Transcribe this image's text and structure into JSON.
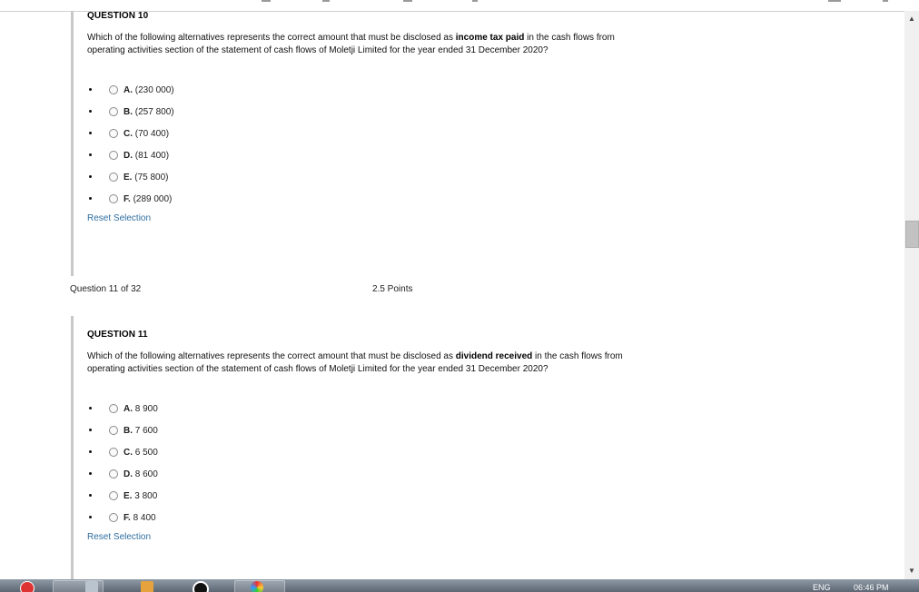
{
  "question10": {
    "heading": "QUESTION 10",
    "text_before": "Which of the following alternatives represents the correct amount that must be disclosed as ",
    "text_bold": "income tax paid",
    "text_after": " in the cash flows from operating activities section of the statement of cash flows of Moletji Limited for the year ended 31 December 2020?",
    "options": [
      {
        "letter": "A.",
        "value": "(230 000)"
      },
      {
        "letter": "B.",
        "value": "(257 800)"
      },
      {
        "letter": "C.",
        "value": "(70 400)"
      },
      {
        "letter": "D.",
        "value": "(81 400)"
      },
      {
        "letter": "E.",
        "value": "(75 800)"
      },
      {
        "letter": "F.",
        "value": "(289 000)"
      }
    ],
    "reset_label": "Reset Selection"
  },
  "progress": {
    "counter": "Question 11 of 32",
    "points": "2.5 Points"
  },
  "question11": {
    "heading": "QUESTION 11",
    "text_before": "Which of the following alternatives represents the correct amount that must be disclosed as ",
    "text_bold": "dividend received",
    "text_after": " in the cash flows from operating activities section of the statement of cash flows of Moletji Limited for the year ended 31 December 2020?",
    "options": [
      {
        "letter": "A.",
        "value": "8 900"
      },
      {
        "letter": "B.",
        "value": "7 600"
      },
      {
        "letter": "C.",
        "value": "6 500"
      },
      {
        "letter": "D.",
        "value": "8 600"
      },
      {
        "letter": "E.",
        "value": "3 800"
      },
      {
        "letter": "F.",
        "value": "8 400"
      }
    ],
    "reset_label": "Reset Selection"
  },
  "taskbar": {
    "language": "ENG",
    "clock": "06:46 PM"
  },
  "colors": {
    "link": "#2f6ea1",
    "question_border": "#c8c8c8",
    "taskbar": "#5c6773"
  }
}
